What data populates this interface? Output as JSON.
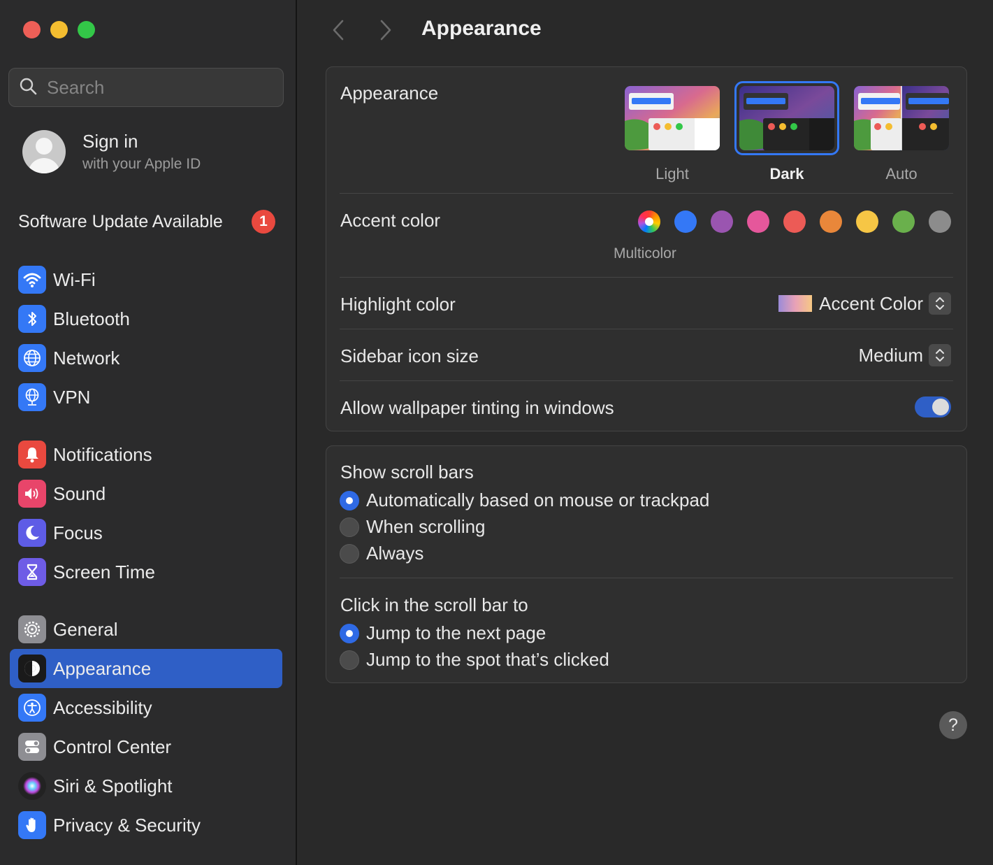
{
  "window": {
    "title": "Appearance"
  },
  "search": {
    "placeholder": "Search"
  },
  "account": {
    "title": "Sign in",
    "subtitle": "with your Apple ID"
  },
  "update": {
    "label": "Software Update Available",
    "count": "1"
  },
  "sidebar": {
    "items": [
      {
        "label": "Wi-Fi",
        "icon": "wifi-icon",
        "color": "#3478f6"
      },
      {
        "label": "Bluetooth",
        "icon": "bluetooth-icon",
        "color": "#3478f6"
      },
      {
        "label": "Network",
        "icon": "globe-icon",
        "color": "#3478f6"
      },
      {
        "label": "VPN",
        "icon": "vpn-globe-icon",
        "color": "#3478f6"
      },
      {
        "label": "Notifications",
        "icon": "bell-icon",
        "color": "#e9493f"
      },
      {
        "label": "Sound",
        "icon": "speaker-icon",
        "color": "#e8456a"
      },
      {
        "label": "Focus",
        "icon": "moon-icon",
        "color": "#5e5ce6"
      },
      {
        "label": "Screen Time",
        "icon": "hourglass-icon",
        "color": "#6e5ce6"
      },
      {
        "label": "General",
        "icon": "gear-icon",
        "color": "#8e8e93"
      },
      {
        "label": "Appearance",
        "icon": "appearance-icon",
        "color": "#1a1a1a",
        "selected": true
      },
      {
        "label": "Accessibility",
        "icon": "accessibility-icon",
        "color": "#3478f6"
      },
      {
        "label": "Control Center",
        "icon": "toggles-icon",
        "color": "#8e8e93"
      },
      {
        "label": "Siri & Spotlight",
        "icon": "siri-icon",
        "color": "#222222"
      },
      {
        "label": "Privacy & Security",
        "icon": "hand-icon",
        "color": "#3478f6"
      }
    ]
  },
  "main": {
    "title": "Appearance",
    "appearance": {
      "label": "Appearance",
      "options": [
        {
          "label": "Light",
          "selected": false
        },
        {
          "label": "Dark",
          "selected": true
        },
        {
          "label": "Auto",
          "selected": false
        }
      ]
    },
    "accent": {
      "label": "Accent color",
      "selected_name": "Multicolor",
      "colors": [
        "multicolor",
        "#3478f6",
        "#9a55b0",
        "#e5579b",
        "#ec5b56",
        "#e9873a",
        "#f6c645",
        "#6ab04c",
        "#8c8c8c"
      ]
    },
    "highlight": {
      "label": "Highlight color",
      "value": "Accent Color"
    },
    "sidebar_icon_size": {
      "label": "Sidebar icon size",
      "value": "Medium"
    },
    "wallpaper_tinting": {
      "label": "Allow wallpaper tinting in windows",
      "enabled": true
    },
    "scroll_bars": {
      "label": "Show scroll bars",
      "options": [
        {
          "label": "Automatically based on mouse or trackpad",
          "selected": true
        },
        {
          "label": "When scrolling",
          "selected": false
        },
        {
          "label": "Always",
          "selected": false
        }
      ]
    },
    "click_scroll": {
      "label": "Click in the scroll bar to",
      "options": [
        {
          "label": "Jump to the next page",
          "selected": true
        },
        {
          "label": "Jump to the spot that’s clicked",
          "selected": false
        }
      ]
    },
    "help": "?"
  }
}
